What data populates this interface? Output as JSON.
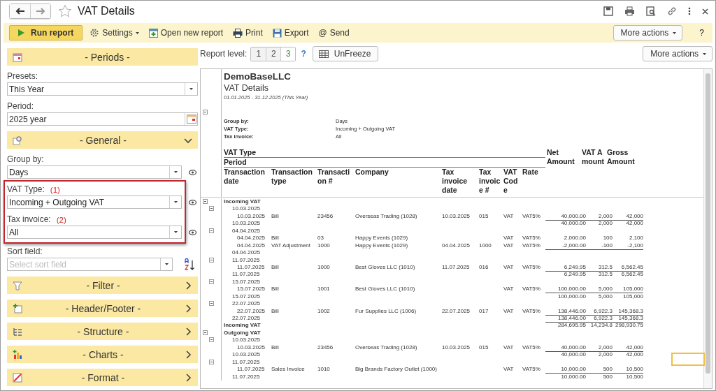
{
  "window": {
    "title": "VAT Details"
  },
  "toolbar": {
    "run": "Run report",
    "items": [
      {
        "kind": "settings",
        "label": "Settings",
        "menu": true
      },
      {
        "kind": "open",
        "label": "Open new report",
        "menu": false
      },
      {
        "kind": "print",
        "label": "Print",
        "menu": false
      },
      {
        "kind": "export",
        "label": "Export",
        "menu": false
      },
      {
        "kind": "send",
        "glyph": "@",
        "label": "Send",
        "menu": false
      }
    ],
    "more_actions": "More actions",
    "help": "?"
  },
  "settings_panel": {
    "sections": [
      {
        "title": "- Periods -",
        "kind": "fixed",
        "fields": [
          {
            "label": "Presets:",
            "kind": "select",
            "value": "This Year",
            "show_in_report": false
          },
          {
            "label": "Period:",
            "kind": "date",
            "value": "2025 year",
            "show_in_report": false
          }
        ]
      },
      {
        "title": "- General -",
        "kind": "collapsible",
        "expanded": true,
        "fields": [
          {
            "label": "Group by:",
            "kind": "select",
            "value": "Days",
            "show_in_report": true,
            "highlighted": false
          },
          {
            "label": "VAT Type:",
            "note": "(1)",
            "kind": "select",
            "value": "Incoming + Outgoing VAT",
            "show_in_report": true,
            "highlighted": true
          },
          {
            "label": "Tax invoice:",
            "note": "(2)",
            "kind": "select",
            "value": "All",
            "show_in_report": true,
            "highlighted": true
          },
          {
            "label": "Sort field:",
            "kind": "sort",
            "placeholder": "Select sort field",
            "show_in_report": false,
            "highlighted": false
          }
        ]
      },
      {
        "title": "- Filter -",
        "kind": "collapsible",
        "expanded": false
      },
      {
        "title": "- Header/Footer -",
        "kind": "collapsible",
        "expanded": false
      },
      {
        "title": "- Structure -",
        "kind": "collapsible",
        "expanded": false
      },
      {
        "title": "- Charts -",
        "kind": "collapsible",
        "expanded": false
      },
      {
        "title": "- Format -",
        "kind": "collapsible",
        "expanded": false
      }
    ]
  },
  "report_toolbar": {
    "level_label": "Report level:",
    "levels": [
      {
        "label": "1",
        "selected": false
      },
      {
        "label": "2",
        "selected": false
      },
      {
        "label": "3",
        "selected": true
      }
    ],
    "help": "?",
    "unfreeze": "UnFreeze",
    "more_actions": "More actions"
  },
  "report": {
    "company": "DemoBaseLLC",
    "title": "VAT Details",
    "period": "01.01.2025 - 31.12.2025 (This Year)",
    "params": [
      {
        "label": "Group by:",
        "value": "Days"
      },
      {
        "label": "VAT Type:",
        "value": "Incoming + Outgoing VAT"
      },
      {
        "label": "Tax invoice:",
        "value": "All"
      }
    ],
    "group_heading": "VAT Type",
    "period_heading": "Period",
    "columns": [
      "Transaction date",
      "Transaction type",
      "Transaction #",
      "Company",
      "Tax invoice date",
      "Tax invoice #",
      "VAT Code",
      "Rate"
    ],
    "amount_columns": [
      "Net Amount",
      "VAT Amount",
      "Gross Amount"
    ],
    "sections": [
      {
        "label": "Incoming VAT",
        "periods": [
          {
            "date": "10.03.2025",
            "rows": [
              {
                "date": "10.03.2025",
                "type": "Bill",
                "number": "23456",
                "company": "Overseas Trading (1028)",
                "tax_date": "10.03.2025",
                "tax_no": "015",
                "vat_code": "VAT",
                "rate": "VAT5%",
                "net": "40,000.00",
                "vat": "2,000",
                "gross": "42,000"
              }
            ],
            "total": {
              "date": "10.03.2025",
              "net": "40,000.00",
              "vat": "2,000",
              "gross": "42,000"
            }
          },
          {
            "date": "04.04.2025",
            "rows": [
              {
                "date": "04.04.2025",
                "type": "Bill",
                "number": "03",
                "company": "Happy Events (1029)",
                "vat_code": "VAT",
                "rate": "VAT5%",
                "net": "2,000.00",
                "vat": "100",
                "gross": "2,100"
              },
              {
                "date": "04.04.2025",
                "type": "VAT Adjustment",
                "number": "1000",
                "company": "Happy Events (1029)",
                "tax_date": "04.04.2025",
                "tax_no": "1000",
                "vat_code": "VAT",
                "rate": "VAT5%",
                "net": "-2,000.00",
                "vat": "-100",
                "gross": "-2,100"
              }
            ],
            "total": {
              "date": "04.04.2025"
            }
          },
          {
            "date": "11.07.2025",
            "rows": [
              {
                "date": "11.07.2025",
                "type": "Bill",
                "number": "1000",
                "company": "Best Gloves LLC (1010)",
                "tax_date": "11.07.2025",
                "tax_no": "016",
                "vat_code": "VAT",
                "rate": "VAT5%",
                "net": "6,249.95",
                "vat": "312.5",
                "gross": "6,562.45"
              }
            ],
            "total": {
              "date": "11.07.2025",
              "net": "6,249.95",
              "vat": "312.5",
              "gross": "6,562.45"
            }
          },
          {
            "date": "15.07.2025",
            "rows": [
              {
                "date": "15.07.2025",
                "type": "Bill",
                "number": "1001",
                "company": "Best Gloves LLC (1010)",
                "vat_code": "VAT",
                "rate": "VAT5%",
                "net": "100,000.00",
                "vat": "5,000",
                "gross": "105,000"
              }
            ],
            "total": {
              "date": "15.07.2025",
              "net": "100,000.00",
              "vat": "5,000",
              "gross": "105,000"
            }
          },
          {
            "date": "22.07.2025",
            "rows": [
              {
                "date": "22.07.2025",
                "type": "Bill",
                "number": "1002",
                "company": "Fur Supplies LLC (1006)",
                "tax_date": "22.07.2025",
                "tax_no": "017",
                "vat_code": "VAT",
                "rate": "VAT5%",
                "net": "138,446.00",
                "vat": "6,922.3",
                "gross": "145,368.3"
              }
            ],
            "total": {
              "date": "22.07.2025",
              "net": "138,446.00",
              "vat": "6,922.3",
              "gross": "145,368.3"
            }
          }
        ],
        "total": {
          "label": "Incoming VAT",
          "net": "284,695.95",
          "vat": "14,234.8",
          "gross": "298,930.75"
        }
      },
      {
        "label": "Outgoing VAT",
        "periods": [
          {
            "date": "10.03.2025",
            "rows": [
              {
                "date": "10.03.2025",
                "type": "Bill",
                "number": "23456",
                "company": "Overseas Trading (1028)",
                "tax_date": "10.03.2025",
                "tax_no": "015",
                "vat_code": "VAT",
                "rate": "VAT5%",
                "net": "40,000.00",
                "vat": "2,000",
                "gross": "42,000"
              }
            ],
            "total": {
              "date": "10.03.2025",
              "net": "40,000.00",
              "vat": "2,000",
              "gross": "42,000"
            }
          },
          {
            "date": "11.07.2025",
            "rows": [
              {
                "date": "11.07.2025",
                "type": "Sales Invoice",
                "number": "1010",
                "company": "Big Brands Factory Outlet (1000)",
                "vat_code": "VAT",
                "rate": "VAT5%",
                "net": "10,000.00",
                "vat": "500",
                "gross": "10,500"
              }
            ],
            "total": {
              "date": "11.07.2025",
              "net": "10,000.00",
              "vat": "500",
              "gross": "10,500"
            }
          }
        ]
      }
    ]
  }
}
